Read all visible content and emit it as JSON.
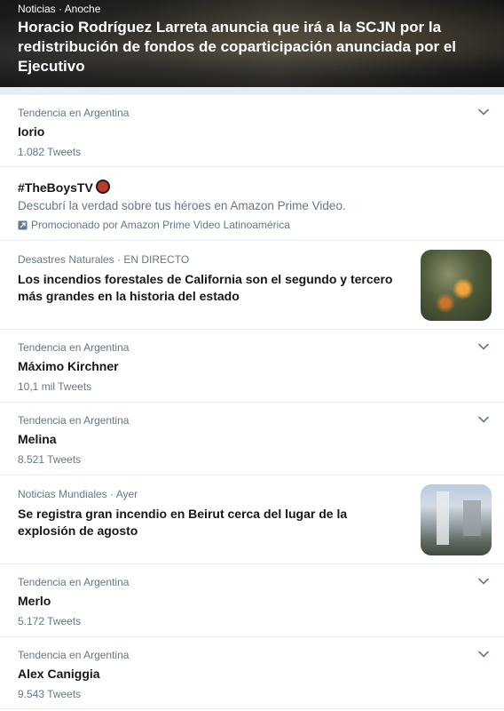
{
  "hero": {
    "meta": "Noticias · Anoche",
    "title": "Horacio Rodríguez Larreta anuncia que irá a la SCJN por la redistribución de fondos de coparticipación anunciada por el Ejecutivo"
  },
  "trends": [
    {
      "meta": "Tendencia en Argentina",
      "name": "Iorio",
      "count": "1.082 Tweets"
    },
    {
      "meta": "Tendencia en Argentina",
      "name": "Máximo Kirchner",
      "count": "10,1 mil Tweets"
    },
    {
      "meta": "Tendencia en Argentina",
      "name": "Melina",
      "count": "8.521 Tweets"
    },
    {
      "meta": "Tendencia en Argentina",
      "name": "Merlo",
      "count": "5.172 Tweets"
    },
    {
      "meta": "Tendencia en Argentina",
      "name": "Alex Caniggia",
      "count": "9.543 Tweets"
    }
  ],
  "promoted": {
    "hashtag": "#TheBoysTV",
    "description": "Descubrí la verdad sobre tus héroes en Amazon Prime Video.",
    "promo_label": "Promocionado por Amazon Prime Video Latinoamérica"
  },
  "news": [
    {
      "meta": "Desastres Naturales · EN DIRECTO",
      "title": "Los incendios forestales de California son el segundo y tercero más grandes en la historia del estado"
    },
    {
      "meta": "Noticias Mundiales · Ayer",
      "title": "Se registra gran incendio en Beirut cerca del lugar de la explosión de agosto"
    }
  ],
  "icons": {
    "chevron": "chevron-down-icon",
    "promoted": "promoted-icon"
  },
  "colors": {
    "text_primary": "#14171a",
    "text_secondary": "#657786",
    "divider": "#e6ecf0"
  }
}
